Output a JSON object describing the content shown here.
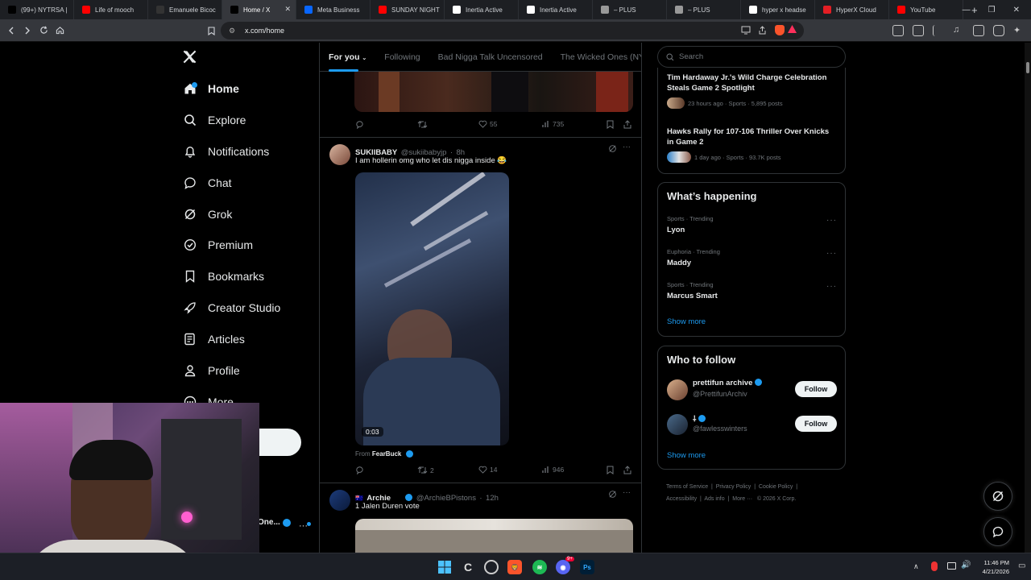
{
  "browser": {
    "tabs": [
      {
        "label": "(99+) NYTRSA |",
        "icon": "tiktok-icon",
        "color": "#000000"
      },
      {
        "label": "Life of mooch",
        "icon": "youtube-icon",
        "color": "#ff0000"
      },
      {
        "label": "Emanuele Bicoc",
        "icon": "s-icon",
        "color": "#333333"
      },
      {
        "label": "Home / X",
        "icon": "x-icon",
        "color": "#000000",
        "active": true
      },
      {
        "label": "Meta Business",
        "icon": "meta-icon",
        "color": "#0866ff"
      },
      {
        "label": "SUNDAY NIGHT",
        "icon": "youtube-icon",
        "color": "#ff0000"
      },
      {
        "label": "Inertia Active",
        "icon": "notion-icon",
        "color": "#ffffff"
      },
      {
        "label": "Inertia Active",
        "icon": "notion-icon",
        "color": "#ffffff"
      },
      {
        "label": "– PLUS",
        "icon": "globe-icon",
        "color": "#999999"
      },
      {
        "label": "– PLUS",
        "icon": "globe-icon",
        "color": "#999999"
      },
      {
        "label": "hyper x headse",
        "icon": "google-icon",
        "color": "#ffffff"
      },
      {
        "label": "HyperX Cloud",
        "icon": "hyperx-icon",
        "color": "#e31e24"
      },
      {
        "label": "YouTube",
        "icon": "youtube-icon",
        "color": "#ff0000"
      }
    ],
    "url": "x.com/home"
  },
  "nav": {
    "items": [
      {
        "label": "Home",
        "icon": "home-icon"
      },
      {
        "label": "Explore",
        "icon": "search-icon"
      },
      {
        "label": "Notifications",
        "icon": "bell-icon"
      },
      {
        "label": "Chat",
        "icon": "chat-bubble-icon"
      },
      {
        "label": "Grok",
        "icon": "grok-icon"
      },
      {
        "label": "Premium",
        "icon": "verified-badge-icon"
      },
      {
        "label": "Bookmarks",
        "icon": "bookmark-icon"
      },
      {
        "label": "Creator Studio",
        "icon": "rocket-icon"
      },
      {
        "label": "Articles",
        "icon": "article-icon"
      },
      {
        "label": "Profile",
        "icon": "person-icon"
      },
      {
        "label": "More",
        "icon": "more-circle-icon"
      }
    ],
    "account_name_fragment": "One..."
  },
  "feed": {
    "tabs": [
      "For you",
      "Following",
      "Bad Nigga Talk Uncensored",
      "The Wicked Ones (NYC)"
    ],
    "post0": {
      "views": "735",
      "likes": "55"
    },
    "post1": {
      "name": "SUKIIBABY",
      "handle": "@sukiibabyjp",
      "time": "8h",
      "text": "I am hollerin omg who let dis nigga inside 😂",
      "video_time": "0:03",
      "from_label": "From",
      "from_name": "FearBuck",
      "retweets": "2",
      "likes": "14",
      "views": "946"
    },
    "post2": {
      "name": "Archie",
      "handle": "@ArchieBPistons",
      "time": "12h",
      "text": "1 Jalen Duren vote"
    }
  },
  "right": {
    "search_placeholder": "Search",
    "news": [
      {
        "title": "Tim Hardaway Jr.'s Wild Charge Celebration Steals Game 2 Spotlight",
        "meta": "23 hours ago · Sports · 5,895 posts"
      },
      {
        "title": "Hawks Rally for 107-106 Thriller Over Knicks in Game 2",
        "meta": "1 day ago · Sports · 93.7K posts"
      }
    ],
    "happening": {
      "heading": "What’s happening",
      "trends": [
        {
          "context": "Sports · Trending",
          "title": "Lyon"
        },
        {
          "context": "Euphoria · Trending",
          "title": "Maddy"
        },
        {
          "context": "Sports · Trending",
          "title": "Marcus Smart"
        }
      ],
      "show_more": "Show more"
    },
    "who_to_follow": {
      "heading": "Who to follow",
      "accounts": [
        {
          "name": "prettifun archive",
          "handle": "@PrettifunArchiv",
          "button": "Follow"
        },
        {
          "name": "⸸",
          "handle": "@fawlesswinters",
          "button": "Follow"
        }
      ],
      "show_more": "Show more"
    },
    "footer": {
      "links": [
        "Terms of Service",
        "Privacy Policy",
        "Cookie Policy",
        "Accessibility",
        "Ads info",
        "More ···"
      ],
      "copyright": "© 2026 X Corp."
    }
  },
  "taskbar": {
    "time": "11:46 PM",
    "date": "4/21/2026",
    "discord_badge": "9+"
  },
  "colors": {
    "accent": "#1d9bf0",
    "background": "#000000",
    "border": "#2f3336",
    "muted": "#71767b"
  }
}
